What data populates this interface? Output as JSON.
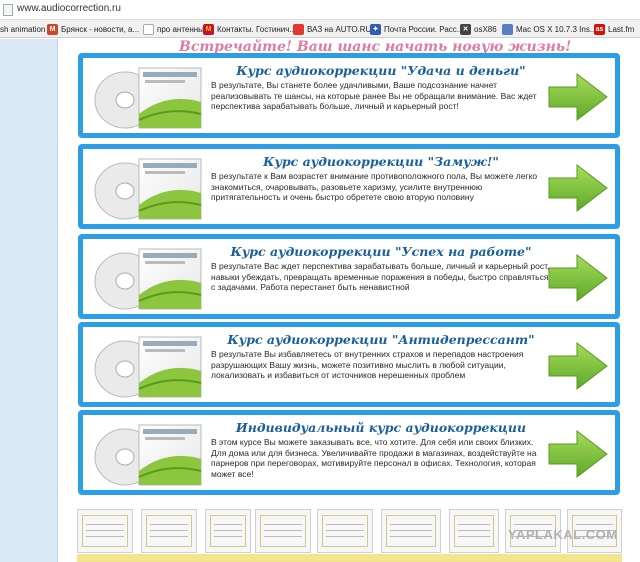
{
  "browser": {
    "url": "www.audiocorrection.ru",
    "bookmarks": [
      {
        "label": "sh animation",
        "icon": "bookmark-icon",
        "color": "#777777"
      },
      {
        "label": "Брянск - новости, а...",
        "icon": "news-icon",
        "color": "#d2452d"
      },
      {
        "label": "про антенны",
        "icon": "page-icon",
        "color": "#aaaaaa"
      },
      {
        "label": "Контакты. Гостинич...",
        "icon": "mcdonalds-icon",
        "color": "#c8102e"
      },
      {
        "label": "ВАЗ на AUTO.RU",
        "icon": "auto-icon",
        "color": "#e23b2d"
      },
      {
        "label": "Почта России. Расс...",
        "icon": "post-icon",
        "color": "#2f5fb3"
      },
      {
        "label": "osX86",
        "icon": "osx-icon",
        "color": "#444444"
      },
      {
        "label": "Mac OS X 10.7.3 Ins...",
        "icon": "mac-icon",
        "color": "#5a7fbf"
      },
      {
        "label": "Last.fm",
        "icon": "lastfm-icon",
        "color": "#d51007"
      }
    ]
  },
  "page": {
    "headline": "Встречайте! Ваш шанс начать новую жизнь!",
    "courses": [
      {
        "title": "Курс аудиокоррекции \"Удача и деньги\"",
        "description": "В результате, Вы станете более удачливыми, Ваше подсознание начнет реализовывать те шансы, на которые ранее Вы не обращали внимание. Вас ждет перспектива зарабатывать больше, личный и карьерный рост!"
      },
      {
        "title": "Курс аудиокоррекции \"Замуж!\"",
        "description": "В результате к Вам возрастет внимание противоположного пола, Вы можете легко знакомиться, очаровывать, разовьете харизму, усилите внутреннюю притягательность и очень быстро обретете свою вторую половину"
      },
      {
        "title": "Курс аудиокоррекции \"Успех на работе\"",
        "description": "В результате Вас ждет перспектива зарабатывать больше, личный и карьерный рост, навыки убеждать, превращать временные поражения в победы, быстро справляться с задачами. Работа перестанет быть ненавистной"
      },
      {
        "title": "Курс аудиокоррекции \"Антидепрессант\"",
        "description": "В результате Вы избавляетесь от внутренних страхов и перепадов настроения разрушающих Вашу жизнь, можете позитивно мыслить в любой ситуации, локализовать и избавиться от источников нерешенных проблем"
      },
      {
        "title": "Индивидуальный курс аудиокоррекции",
        "description": "В этом курсе Вы можете заказывать все, что хотите. Для себя или своих близких. Для дома или для бизнеса. Увеличивайте продажи в магазинах, воздействуйте на парнеров при переговорах, мотивируйте персонал в офисах. Технология, которая может все!"
      }
    ],
    "certificates_count": 9,
    "watermark": "YAPLAKAL.COM"
  },
  "colors": {
    "card_border": "#2c9ee7",
    "title_blue": "#1a5f9c",
    "headline_pink": "#e07aa6",
    "arrow_green": "#7cc242",
    "cover_green": "#8cc63f"
  }
}
